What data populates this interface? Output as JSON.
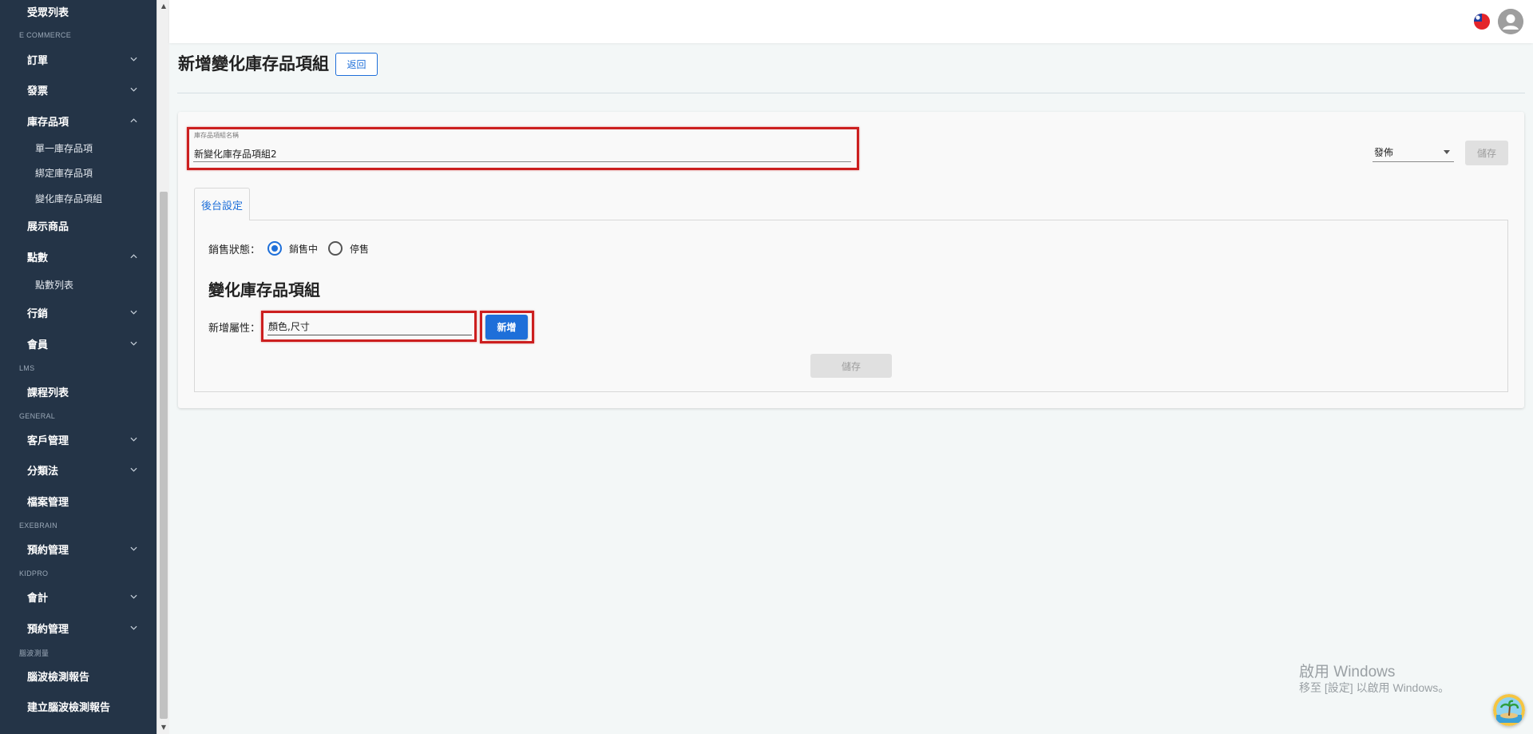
{
  "sidebar": {
    "items": [
      {
        "label": "受眾列表",
        "kind": "item"
      },
      {
        "label": "E COMMERCE",
        "kind": "section"
      },
      {
        "label": "訂單",
        "kind": "item",
        "chevron": "down"
      },
      {
        "label": "發票",
        "kind": "item",
        "chevron": "down"
      },
      {
        "label": "庫存品項",
        "kind": "item",
        "chevron": "up"
      },
      {
        "label": "單一庫存品項",
        "kind": "sub"
      },
      {
        "label": "綁定庫存品項",
        "kind": "sub"
      },
      {
        "label": "變化庫存品項組",
        "kind": "sub"
      },
      {
        "label": "展示商品",
        "kind": "item"
      },
      {
        "label": "點數",
        "kind": "item",
        "chevron": "up"
      },
      {
        "label": "點數列表",
        "kind": "sub"
      },
      {
        "label": "行銷",
        "kind": "item",
        "chevron": "down"
      },
      {
        "label": "會員",
        "kind": "item",
        "chevron": "down"
      },
      {
        "label": "LMS",
        "kind": "section"
      },
      {
        "label": "課程列表",
        "kind": "item"
      },
      {
        "label": "GENERAL",
        "kind": "section"
      },
      {
        "label": "客戶管理",
        "kind": "item",
        "chevron": "down"
      },
      {
        "label": "分類法",
        "kind": "item",
        "chevron": "down"
      },
      {
        "label": "檔案管理",
        "kind": "item"
      },
      {
        "label": "EXEBRAIN",
        "kind": "section"
      },
      {
        "label": "預約管理",
        "kind": "item",
        "chevron": "down"
      },
      {
        "label": "KIDPRO",
        "kind": "section"
      },
      {
        "label": "會計",
        "kind": "item",
        "chevron": "down"
      },
      {
        "label": "預約管理",
        "kind": "item",
        "chevron": "down"
      },
      {
        "label": "腦波測量",
        "kind": "section"
      },
      {
        "label": "腦波檢測報告",
        "kind": "item"
      },
      {
        "label": "建立腦波檢測報告",
        "kind": "item"
      }
    ]
  },
  "header": {
    "flag_icon": "taiwan-flag-icon",
    "avatar_icon": "user-avatar-icon"
  },
  "page": {
    "title": "新增變化庫存品項組",
    "back_label": "返回"
  },
  "form": {
    "name_label": "庫存品項組名稱",
    "name_value": "新變化庫存品項組2",
    "publish_value": "發佈",
    "save_label": "儲存"
  },
  "tabs": [
    {
      "label": "後台設定",
      "active": true
    }
  ],
  "backend": {
    "sales_status_label": "銷售狀態：",
    "options": [
      {
        "label": "銷售中",
        "checked": true
      },
      {
        "label": "停售",
        "checked": false
      }
    ],
    "section_title": "變化庫存品項組",
    "attr_label": "新增屬性：",
    "attr_value": "顏色,尺寸",
    "add_label": "新增",
    "save_label": "儲存"
  },
  "watermark": {
    "line1": "啟用 Windows",
    "line2": "移至 [設定] 以啟用 Windows。"
  },
  "colors": {
    "sidebar_bg": "#243447",
    "accent": "#1e6fd9",
    "highlight": "#cc1f1f",
    "disabled_bg": "#e0e0e0"
  }
}
